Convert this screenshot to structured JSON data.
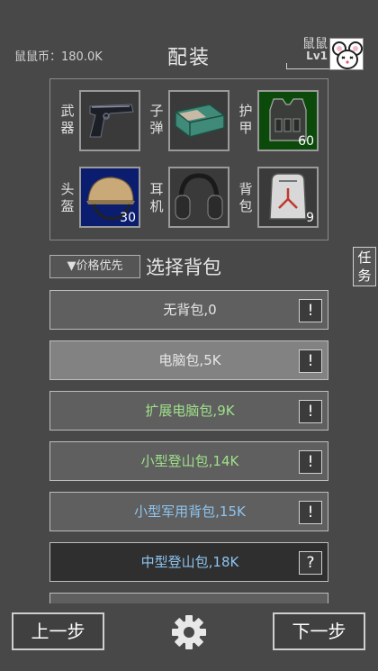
{
  "header": {
    "currency": "鼠鼠币：180.0K",
    "title": "配装",
    "player_name": "鼠鼠",
    "player_level": "Lv1"
  },
  "equipment": [
    {
      "label": "武器",
      "icon": "pistol-icon",
      "count": ""
    },
    {
      "label": "子弹",
      "icon": "ammo-box-icon",
      "count": ""
    },
    {
      "label": "护甲",
      "icon": "armor-vest-icon",
      "count": "60"
    },
    {
      "label": "头盔",
      "icon": "helmet-icon",
      "count": "30"
    },
    {
      "label": "耳机",
      "icon": "headset-icon",
      "count": ""
    },
    {
      "label": "背包",
      "icon": "backpack-icon",
      "count": "9"
    }
  ],
  "sort": {
    "label": "▼价格优先"
  },
  "section_title": "选择背包",
  "task_button": "任务",
  "bags": [
    {
      "name": "无背包,0",
      "color": "#e6e6e6",
      "info": "!"
    },
    {
      "name": "电脑包,5K",
      "color": "#e6e6e6",
      "info": "!"
    },
    {
      "name": "扩展电脑包,9K",
      "color": "#9fe08a",
      "info": "!"
    },
    {
      "name": "小型登山包,14K",
      "color": "#9fe08a",
      "info": "!"
    },
    {
      "name": "小型军用背包,15K",
      "color": "#8ec4ef",
      "info": "!"
    },
    {
      "name": "中型登山包,18K",
      "color": "#8ec4ef",
      "info": "?"
    }
  ],
  "footer": {
    "prev_label": "上一步",
    "next_label": "下一步",
    "settings_icon": "gear-icon"
  }
}
